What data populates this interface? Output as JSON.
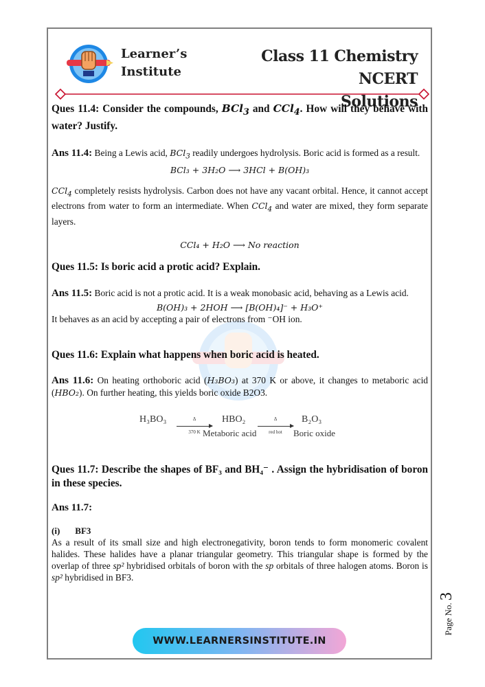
{
  "header": {
    "brand_line1": "Learner’s",
    "brand_line2": "Institute",
    "title_line1": "Class 11 Chemistry NCERT",
    "title_line2": "Solutions"
  },
  "q4": {
    "q_pre": "Ques 11.4: Consider the compounds, ",
    "m1": "BCl",
    "m1s": "3",
    "q_and": " and ",
    "m2": "CCl",
    "m2s": "4",
    "q_post": ". How will they behave with water? Justify.",
    "a_label": "Ans 11.4:",
    "a_text1a": " Being a Lewis acid, ",
    "a_text1b": " readily undergoes hydrolysis. Boric acid is formed as a result.",
    "eq1": "BCl₃ + 3H₂O ⟶ 3HCl + B(OH)₃",
    "a_text2a": " completely resists hydrolysis. Carbon does not have any vacant orbital. Hence, it cannot accept electrons from water to form an intermediate. When ",
    "a_text2b": "  and water are mixed, they form separate layers.",
    "eq2": "CCl₄ + H₂O ⟶ No reaction"
  },
  "q5": {
    "question": "Ques 11.5: Is boric acid a protic acid? Explain.",
    "a_label": "Ans 11.5:",
    "a_text": " Boric acid is not a protic acid. It is a weak monobasic acid, behaving as a Lewis acid.",
    "eq": "B(OH)₃ + 2HOH ⟶ [B(OH)₄]⁻ + H₃O⁺",
    "a_text2": "It behaves as an acid by accepting a pair of electrons from ⁻OH ion."
  },
  "q6": {
    "question": "Ques 11.6: Explain what happens when boric acid is heated.",
    "a_label": "Ans 11.6:",
    "a_text1": " On heating orthoboric acid (",
    "f1": "H₃BO₃",
    "a_text2": ") at 370 K or above, it changes to metaboric acid (",
    "f2": "HBO₂",
    "a_text3": "). On further heating, this yields boric oxide B2O3.",
    "r_h3bo3": "H₃BO₃",
    "r_arrow1_top": "Δ",
    "r_arrow1_bottom": "370 K",
    "r_hbo2": "HBO₂",
    "r_arrow2_top": "Δ",
    "r_arrow2_bottom": "red hot",
    "r_b2o3": "B₂O₃",
    "r_label1": "Metaboric acid",
    "r_label2": "Boric oxide"
  },
  "q7": {
    "q_pre": "Ques 11.7: Describe the shapes of BF₃ and ",
    "q_bh": "BH₄⁻",
    "q_post": " . Assign the hybridisation of boron in these species.",
    "a_label": "Ans 11.7:",
    "sub_num": "(i)",
    "sub_title": "BF3",
    "p1": "As a result of its small size and high electronegativity, boron tends to form monomeric covalent halides. These halides have a planar triangular geometry. This triangular shape is formed by the overlap of three ",
    "sp2": "sp²",
    "p2": " hybridised orbitals of boron with the ",
    "sp": "sp",
    "p3": " orbitals of three halogen atoms. Boron is ",
    "p4": " hybridised in BF3."
  },
  "footer": {
    "page_label": "Page No. ",
    "page_number": "3",
    "website": "WWW.LEARNERSINSTITUTE.IN"
  },
  "colors": {
    "accent_red": "#c8102e",
    "logo_blue": "#1e88e5",
    "frame": "#7f7f7f"
  }
}
